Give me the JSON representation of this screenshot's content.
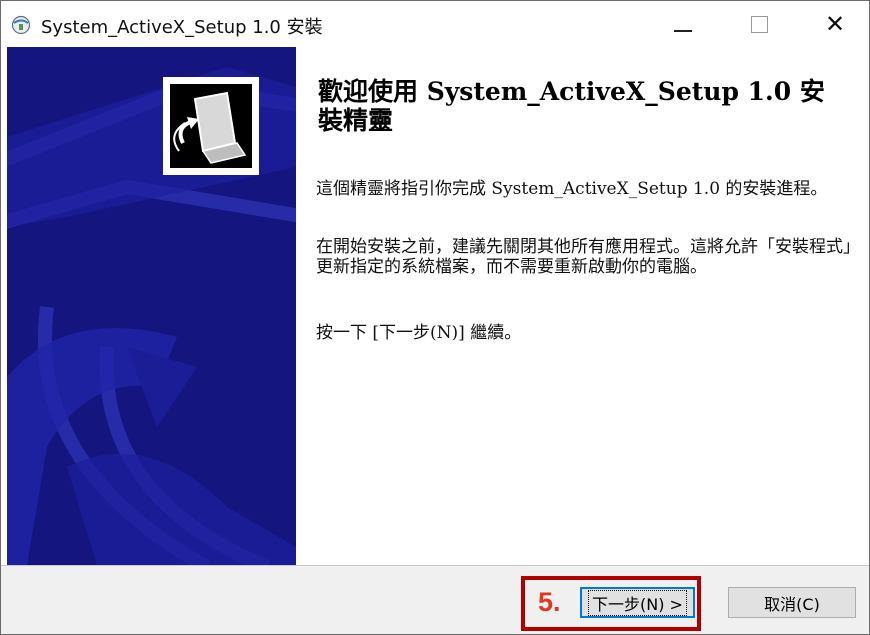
{
  "window": {
    "title": "System_ActiveX_Setup 1.0 安裝",
    "minimize_icon": "minimize-icon",
    "maximize_icon": "maximize-icon",
    "close_label": "✕"
  },
  "content": {
    "heading": "歡迎使用 System_ActiveX_Setup 1.0 安裝精靈",
    "paragraph1": "這個精靈將指引你完成 System_ActiveX_Setup 1.0 的安裝進程。",
    "paragraph2": "在開始安裝之前，建議先關閉其他所有應用程式。這將允許「安裝程式」更新指定的系統檔案，而不需要重新啟動你的電腦。",
    "paragraph3": "按一下 [下一步(N)] 繼續。"
  },
  "buttons": {
    "next_label": "下一步(N) >",
    "cancel_label": "取消(C)"
  },
  "annotation": {
    "step_label": "5."
  },
  "colors": {
    "side_panel": "#14157f",
    "annotation_red": "#b00000",
    "annotation_text": "#e03a1e"
  }
}
